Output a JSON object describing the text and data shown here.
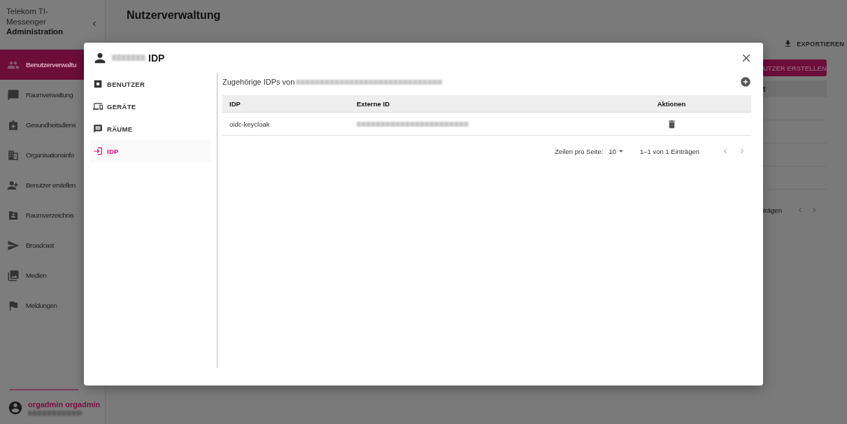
{
  "sidebar": {
    "title_lines": [
      "Telekom TI-",
      "Messenger"
    ],
    "subtitle": "Administration",
    "items": [
      {
        "label": "Benutzerverwaltu",
        "kind": "people",
        "selected": true
      },
      {
        "label": "Raumverwaltung",
        "kind": "chat",
        "selected": false
      },
      {
        "label": "Gesundheitsdiens",
        "kind": "medkit",
        "selected": false
      },
      {
        "label": "Organisationsinfo",
        "kind": "building",
        "selected": false
      },
      {
        "label": "Benutzer erstellen",
        "kind": "person-add",
        "selected": false
      },
      {
        "label": "Raumverzeichnis",
        "kind": "folder",
        "selected": false
      },
      {
        "label": "Broadcast",
        "kind": "send",
        "selected": false
      },
      {
        "label": "Medien",
        "kind": "images",
        "selected": false
      },
      {
        "label": "Meldungen",
        "kind": "flag",
        "selected": false
      }
    ],
    "user": {
      "name": "orgadmin orgadmin"
    }
  },
  "page": {
    "title": "Nutzerverwaltung",
    "export_button": "EXPORTIEREN",
    "create_button": "UTZER ERSTELLEN",
    "table_header": "t",
    "pagination": "trägen"
  },
  "dialog": {
    "title": "IDP",
    "tabs": [
      {
        "label": "BENUTZER",
        "kind": "account",
        "selected": false
      },
      {
        "label": "GERÄTE",
        "kind": "devices",
        "selected": false
      },
      {
        "label": "RÄUME",
        "kind": "message",
        "selected": false
      },
      {
        "label": "IDP",
        "kind": "login",
        "selected": true
      }
    ],
    "section_title": "Zugehörige IDPs von",
    "table": {
      "columns": [
        "IDP",
        "Externe ID",
        "Aktionen"
      ],
      "rows": [
        {
          "idp": "oidc-keycloak"
        }
      ]
    },
    "pagination": {
      "rows_label": "Zeilen pro Seite:",
      "rows_value": "10",
      "range": "1–1 von 1 Einträgen"
    }
  }
}
